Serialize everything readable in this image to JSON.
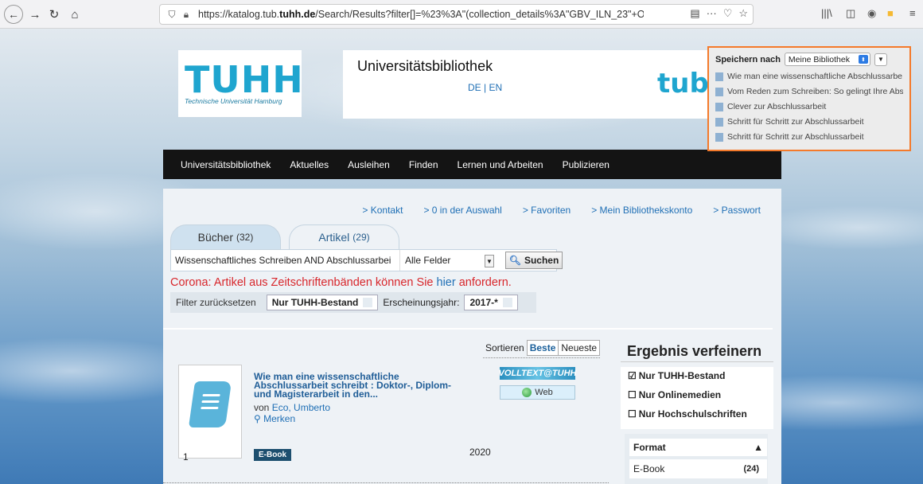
{
  "browser": {
    "url_prefix": "https://katalog.tub.",
    "url_domain": "tuhh.de",
    "url_rest": "/Search/Results?filter[]=%23%3A\"(collection_details%3A\"GBV_ILN_23\"+OR+collectio",
    "icons": [
      "back-icon",
      "forward-icon",
      "reload-icon",
      "home-icon",
      "shield-icon",
      "lock-icon",
      "reader-view-icon",
      "more-icon",
      "pocket-icon",
      "bookmark-star-icon",
      "library-icon",
      "sidebar-icon",
      "zotero-icon",
      "folder-icon",
      "menu-icon"
    ]
  },
  "header": {
    "logo_text": "TUHH",
    "logo_subtitle": "Technische Universität Hamburg",
    "title": "Universitätsbibliothek",
    "lang": "DE | EN",
    "tub_logo": "tub."
  },
  "nav": {
    "items": [
      "Universitätsbibliothek",
      "Aktuelles",
      "Ausleihen",
      "Finden",
      "Lernen und Arbeiten",
      "Publizieren"
    ]
  },
  "links": [
    "> Kontakt",
    "> 0 in der Auswahl",
    "> Favoriten",
    "> Mein Bibliothekskonto",
    "> Passwort"
  ],
  "tabs": [
    {
      "label": "Bücher",
      "count": "(32)"
    },
    {
      "label": "Artikel",
      "count": "(29)"
    }
  ],
  "search": {
    "query": "Wissenschaftliches Schreiben AND Abschlussarbei",
    "field": "Alle Felder",
    "button": "Suchen"
  },
  "notice": {
    "part1": "Corona: Artikel aus Zeitschriftenbänden können Sie ",
    "link": "hier",
    "part2": " anfordern."
  },
  "filters": {
    "reset": "Filter zurücksetzen",
    "chip1": "Nur TUHH-Bestand",
    "label": "Erscheinungsjahr:",
    "chip2": "2017-*"
  },
  "sort": {
    "label": "Sortieren",
    "opt1": "Beste",
    "opt2": "Neueste"
  },
  "result": {
    "number": "1",
    "title": "Wie man eine wissenschaftliche Abschlussarbeit schreibt : Doktor-, Diplom- und Magisterarbeit in den...",
    "author_prefix": "von ",
    "author": "Eco, Umberto",
    "merken": "Merken",
    "type": "E-Book",
    "year": "2020",
    "volltext": "VOLLTEXT@TUHH",
    "web": "Web"
  },
  "sidebar": {
    "heading": "Ergebnis verfeinern",
    "checks": [
      {
        "label": "Nur TUHH-Bestand",
        "checked": true
      },
      {
        "label": "Nur Onlinemedien",
        "checked": false
      },
      {
        "label": "Nur Hochschulschriften",
        "checked": false
      }
    ],
    "format_label": "Format",
    "format_item": "E-Book",
    "format_count": "(24)"
  },
  "popup": {
    "save_to": "Speichern nach",
    "library": "Meine Bibliothek",
    "items": [
      "Wie man eine wissenschaftliche Abschlussarbe...",
      "Vom Reden zum Schreiben: So gelingt Ihre Abs...",
      "Clever zur Abschlussarbeit",
      "Schritt für Schritt zur Abschlussarbeit",
      "Schritt für Schritt zur Abschlussarbeit"
    ]
  }
}
